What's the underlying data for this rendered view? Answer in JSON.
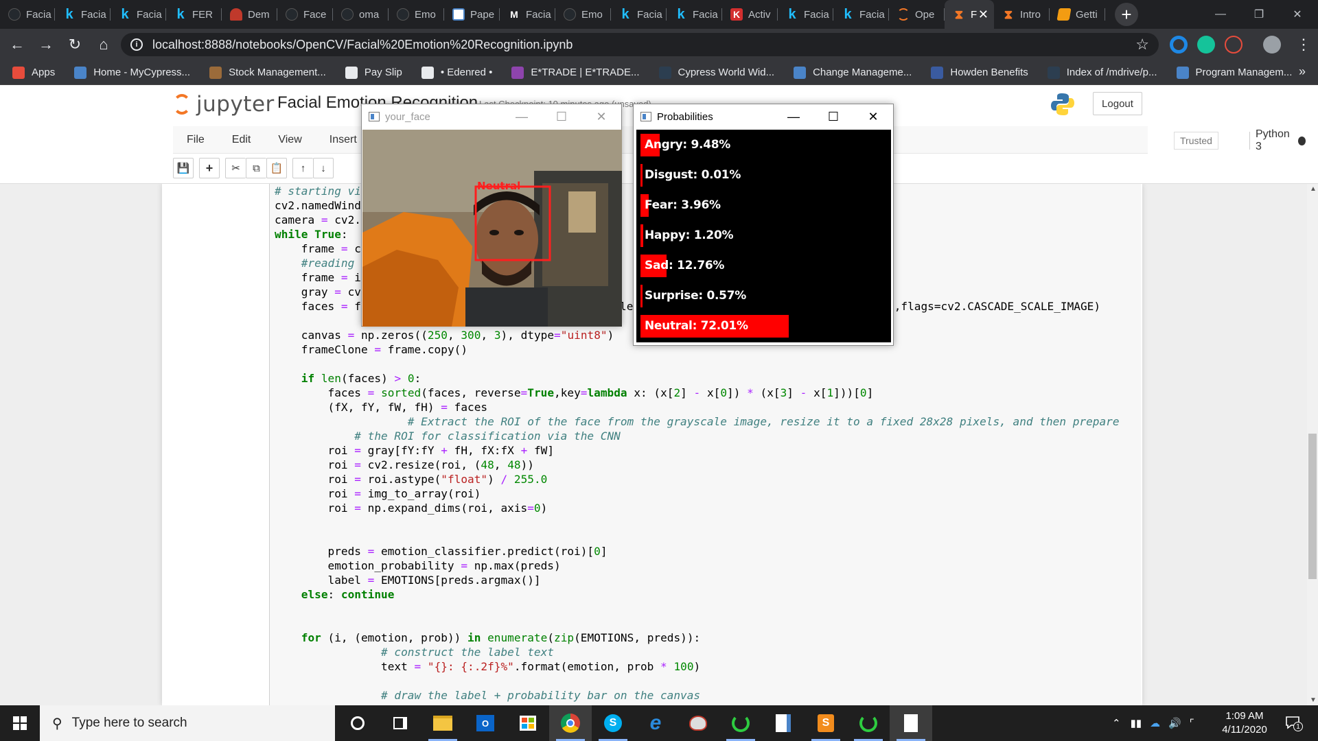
{
  "browser": {
    "tabs": [
      {
        "label": "Facia",
        "icon": "github-icon",
        "color": "#24292e"
      },
      {
        "label": "Facia",
        "icon": "kaggle-icon",
        "color": "#20beff"
      },
      {
        "label": "Facia",
        "icon": "kaggle-icon",
        "color": "#20beff"
      },
      {
        "label": "FER",
        "icon": "kaggle-icon",
        "color": "#20beff"
      },
      {
        "label": "Dem",
        "icon": "person-icon",
        "color": "#c0392b"
      },
      {
        "label": "Face",
        "icon": "github-icon",
        "color": "#24292e"
      },
      {
        "label": "oma",
        "icon": "github-icon",
        "color": "#24292e"
      },
      {
        "label": "Emo",
        "icon": "github-icon",
        "color": "#24292e"
      },
      {
        "label": "Pape",
        "icon": "document-icon",
        "color": "#4a84c8"
      },
      {
        "label": "Facia",
        "icon": "medium-icon",
        "color": "#ffffff"
      },
      {
        "label": "Emo",
        "icon": "github-icon",
        "color": "#24292e"
      },
      {
        "label": "Facia",
        "icon": "kaggle-icon",
        "color": "#20beff"
      },
      {
        "label": "Facia",
        "icon": "kaggle-icon",
        "color": "#20beff"
      },
      {
        "label": "Activ",
        "icon": "k-red-icon",
        "color": "#d32f2f"
      },
      {
        "label": "Facia",
        "icon": "kaggle-icon",
        "color": "#20beff"
      },
      {
        "label": "Facia",
        "icon": "kaggle-icon",
        "color": "#20beff"
      },
      {
        "label": "Ope",
        "icon": "jupyter-icon",
        "color": "#f37726"
      },
      {
        "label": "F",
        "icon": "hourglass-icon",
        "color": "#f37726",
        "active": true
      },
      {
        "label": "Intro",
        "icon": "hourglass-icon",
        "color": "#f37726"
      },
      {
        "label": "Getti",
        "icon": "notebook-icon",
        "color": "#f39c12"
      }
    ],
    "url": "localhost:8888/notebooks/OpenCV/Facial%20Emotion%20Recognition.ipynb",
    "bookmarks": [
      {
        "label": "Apps",
        "color": "#e74c3c"
      },
      {
        "label": "Home - MyCypress...",
        "color": "#4a84c8"
      },
      {
        "label": "Stock Management...",
        "color": "#9b6b3a"
      },
      {
        "label": "Pay Slip",
        "color": "#e8eaed"
      },
      {
        "label": "• Edenred •",
        "color": "#e8eaed"
      },
      {
        "label": "E*TRADE | E*TRADE...",
        "color": "#8e44ad"
      },
      {
        "label": "Cypress World Wid...",
        "color": "#2c3e50"
      },
      {
        "label": "Change Manageme...",
        "color": "#4a84c8"
      },
      {
        "label": "Howden Benefits",
        "color": "#3a5ba0"
      },
      {
        "label": "Index of /mdrive/p...",
        "color": "#2c3e50"
      },
      {
        "label": "Program Managem...",
        "color": "#4a84c8"
      }
    ],
    "bookmarks_more": "»"
  },
  "jupyter": {
    "brand": "jupyter",
    "notebook_title": "Facial Emotion Recognition",
    "checkpoint": "Last Checkpoint: 10 minutes ago (unsaved)",
    "logout_label": "Logout",
    "menu": [
      "File",
      "Edit",
      "View",
      "Insert"
    ],
    "trusted_label": "Trusted",
    "kernel_label": "Python 3"
  },
  "code_lines": [
    "# starting vi",
    "cv2.namedWind",
    "camera = cv2.",
    "while True:",
    "    frame = c",
    "    #reading",
    "    frame = i",
    "    gray = cv",
    "    faces = f",
    "",
    "    canvas = np.zeros((250, 300, 3), dtype=\"uint8\")",
    "    frameClone = frame.copy()",
    "",
    "    if len(faces) > 0:",
    "        faces = sorted(faces, reverse=True,key=lambda x: (x[2] - x[0]) * (x[3] - x[1]))[0]",
    "        (fX, fY, fW, fH) = faces",
    "                    # Extract the ROI of the face from the grayscale image, resize it to a fixed 28x28 pixels, and then prepare",
    "            # the ROI for classification via the CNN",
    "        roi = gray[fY:fY + fH, fX:fX + fW]",
    "        roi = cv2.resize(roi, (48, 48))",
    "        roi = roi.astype(\"float\") / 255.0",
    "        roi = img_to_array(roi)",
    "        roi = np.expand_dims(roi, axis=0)",
    "",
    "",
    "        preds = emotion_classifier.predict(roi)[0]",
    "        emotion_probability = np.max(preds)",
    "        label = EMOTIONS[preds.argmax()]",
    "    else: continue",
    "",
    "",
    "    for (i, (emotion, prob)) in enumerate(zip(EMOTIONS, preds)):",
    "                # construct the label text",
    "                text = \"{}: {:.2f}%\".format(emotion, prob * 100)",
    "",
    "                # draw the label + probability bar on the canvas"
  ],
  "code_line8_tail": "),flags=cv2.CASCADE_SCALE_IMAGE)",
  "code_line8_mid": "le",
  "face_window": {
    "title": "your_face",
    "label": "Neutral"
  },
  "prob_window": {
    "title": "Probabilities",
    "emotions": [
      {
        "name": "Angry",
        "text": "Angry: 9.48%",
        "probability": 9.48
      },
      {
        "name": "Disgust",
        "text": "Disgust: 0.01%",
        "probability": 0.01
      },
      {
        "name": "Fear",
        "text": "Fear: 3.96%",
        "probability": 3.96
      },
      {
        "name": "Happy",
        "text": "Happy: 1.20%",
        "probability": 1.2
      },
      {
        "name": "Sad",
        "text": "Sad: 12.76%",
        "probability": 12.76
      },
      {
        "name": "Surprise",
        "text": "Surprise: 0.57%",
        "probability": 0.57
      },
      {
        "name": "Neutral",
        "text": "Neutral: 72.01%",
        "probability": 72.01
      }
    ],
    "bar_color": "#ff0000"
  },
  "taskbar": {
    "search_placeholder": "Type here to search",
    "time": "1:09 AM",
    "date": "4/11/2020",
    "notification_count": "1"
  }
}
